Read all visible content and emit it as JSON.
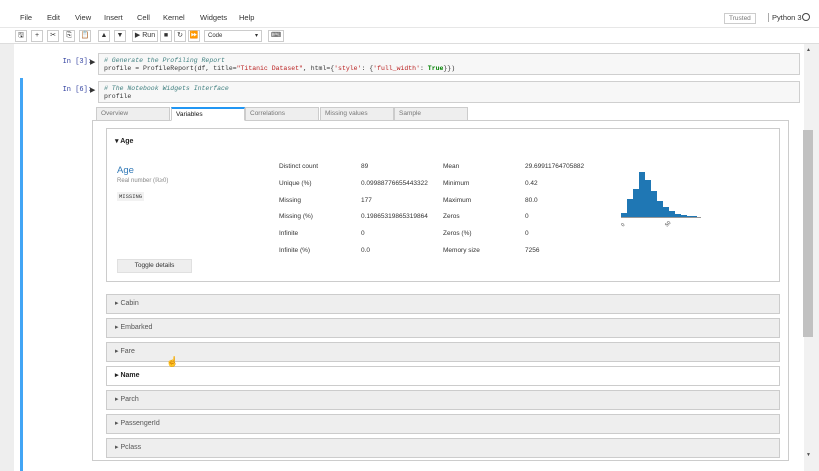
{
  "menubar": {
    "items": [
      "File",
      "Edit",
      "View",
      "Insert",
      "Cell",
      "Kernel",
      "Widgets",
      "Help"
    ],
    "trusted": "Trusted",
    "kernel": "Python 3"
  },
  "toolbar": {
    "run_label": "Run",
    "cell_type": "Code"
  },
  "cells": [
    {
      "prompt": "In [3]:",
      "line1": "# Generate the Profiling Report",
      "line2_a": "profile = ProfileReport(df, title=",
      "line2_str1": "\"Titanic Dataset\"",
      "line2_b": ", html={",
      "line2_str2": "'style'",
      "line2_c": ": {",
      "line2_str3": "'full_width'",
      "line2_d": ": ",
      "line2_kw": "True",
      "line2_e": "}})"
    },
    {
      "prompt": "In [6]:",
      "line1": "# The Notebook Widgets Interface",
      "line2": "profile"
    }
  ],
  "widget": {
    "tabs": [
      "Overview",
      "Variables",
      "Correlations",
      "Missing values",
      "Sample"
    ],
    "active_tab": "Variables",
    "open_var": {
      "header": "Age",
      "name": "Age",
      "type": "Real number (ℝ≥0)",
      "badge": "MISSING",
      "stats_left": [
        {
          "label": "Distinct count",
          "value": "89"
        },
        {
          "label": "Unique (%)",
          "value": "0.09988776655443322"
        },
        {
          "label": "Missing",
          "value": "177"
        },
        {
          "label": "Missing (%)",
          "value": "0.19865319865319864"
        },
        {
          "label": "Infinite",
          "value": "0"
        },
        {
          "label": "Infinite (%)",
          "value": "0.0"
        }
      ],
      "stats_right": [
        {
          "label": "Mean",
          "value": "29.69911764705882"
        },
        {
          "label": "Minimum",
          "value": "0.42"
        },
        {
          "label": "Maximum",
          "value": "80.0"
        },
        {
          "label": "Zeros",
          "value": "0"
        },
        {
          "label": "Zeros (%)",
          "value": "0"
        },
        {
          "label": "Memory size",
          "value": "7256"
        }
      ],
      "toggle": "Toggle details",
      "hist_ticks": [
        "0",
        "50"
      ],
      "hist_color": "#1f77b4"
    },
    "collapsed_vars": [
      "Cabin",
      "Embarked",
      "Fare",
      "Name",
      "Parch",
      "PassengerId",
      "Pclass"
    ],
    "hovered_var": "Name"
  }
}
